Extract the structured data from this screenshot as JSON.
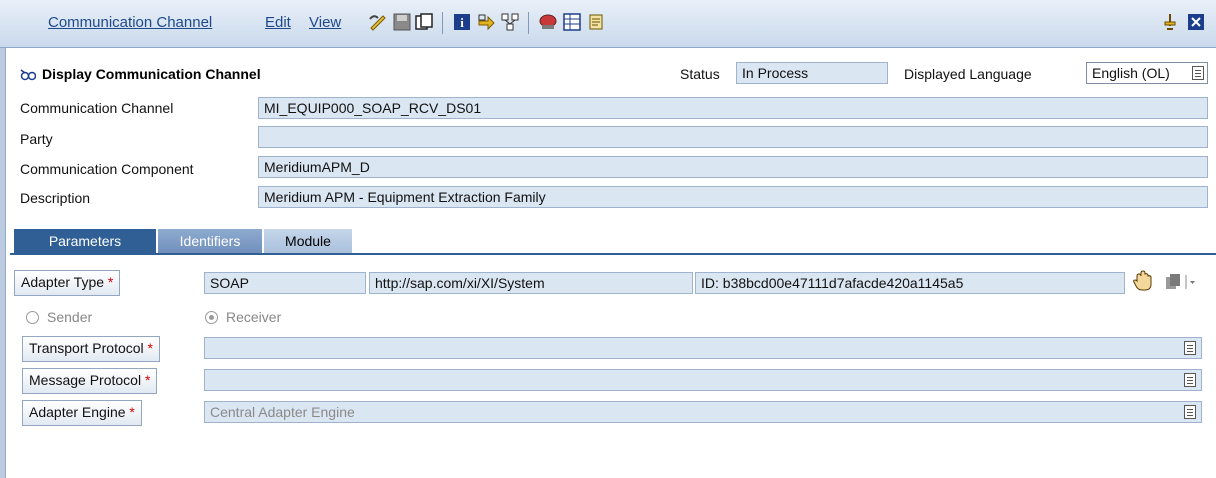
{
  "menu": {
    "communication_channel": "Communication Channel",
    "edit": "Edit",
    "view": "View"
  },
  "header": {
    "title": "Display Communication Channel",
    "status_label": "Status",
    "status_value": "In Process",
    "language_label": "Displayed Language",
    "language_value": "English (OL)"
  },
  "fields": {
    "communication_channel_label": "Communication Channel",
    "communication_channel_value": "MI_EQUIP000_SOAP_RCV_DS01",
    "party_label": "Party",
    "party_value": "",
    "communication_component_label": "Communication Component",
    "communication_component_value": "MeridiumAPM_D",
    "description_label": "Description",
    "description_value": "Meridium APM - Equipment Extraction Family"
  },
  "tabs": [
    {
      "label": "Parameters"
    },
    {
      "label": "Identifiers"
    },
    {
      "label": "Module"
    }
  ],
  "parameters": {
    "adapter_type_label": "Adapter Type",
    "required_mark": "*",
    "adapter_type_value": "SOAP",
    "adapter_namespace": "http://sap.com/xi/XI/System",
    "adapter_id": "ID: b38bcd00e47111d7afacde420a1145a5",
    "sender_label": "Sender",
    "receiver_label": "Receiver",
    "transport_protocol_label": "Transport Protocol",
    "transport_protocol_value": "",
    "message_protocol_label": "Message Protocol",
    "message_protocol_value": "",
    "adapter_engine_label": "Adapter Engine",
    "adapter_engine_value": "Central Adapter Engine"
  }
}
